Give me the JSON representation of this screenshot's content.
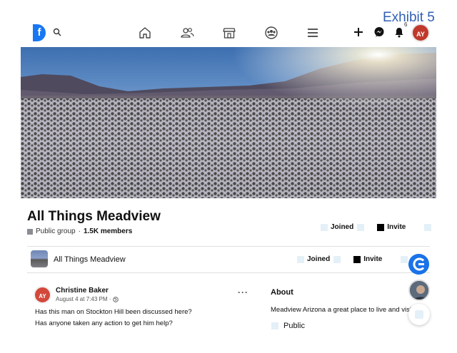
{
  "overlay": {
    "exhibit_label": "Exhibit 5"
  },
  "topnav": {
    "logo_letter": "f",
    "notification_count": "6",
    "profile_initials": "AY"
  },
  "group": {
    "title": "All Things Meadview",
    "privacy": "Public group",
    "separator": " · ",
    "members": "1.5K members",
    "joined_label": "Joined",
    "invite_label": "Invite"
  },
  "sticky": {
    "name": "All Things Meadview",
    "joined_label": "Joined",
    "invite_label": "Invite"
  },
  "post": {
    "author": "Christine Baker",
    "timestamp": "August 4 at 7:43 PM ·",
    "author_initials": "AY",
    "more": "···",
    "lines": [
      "Has this man on Stockton Hill been discussed here?",
      "Has anyone taken any action to get him help?"
    ]
  },
  "about": {
    "title": "About",
    "description": "Meadview Arizona a great place to live and visit.",
    "public_label": "Public"
  },
  "colors": {
    "brand": "#1877f2",
    "exhibit": "#2f5fb3",
    "placeholder": "#e4f0f7"
  }
}
